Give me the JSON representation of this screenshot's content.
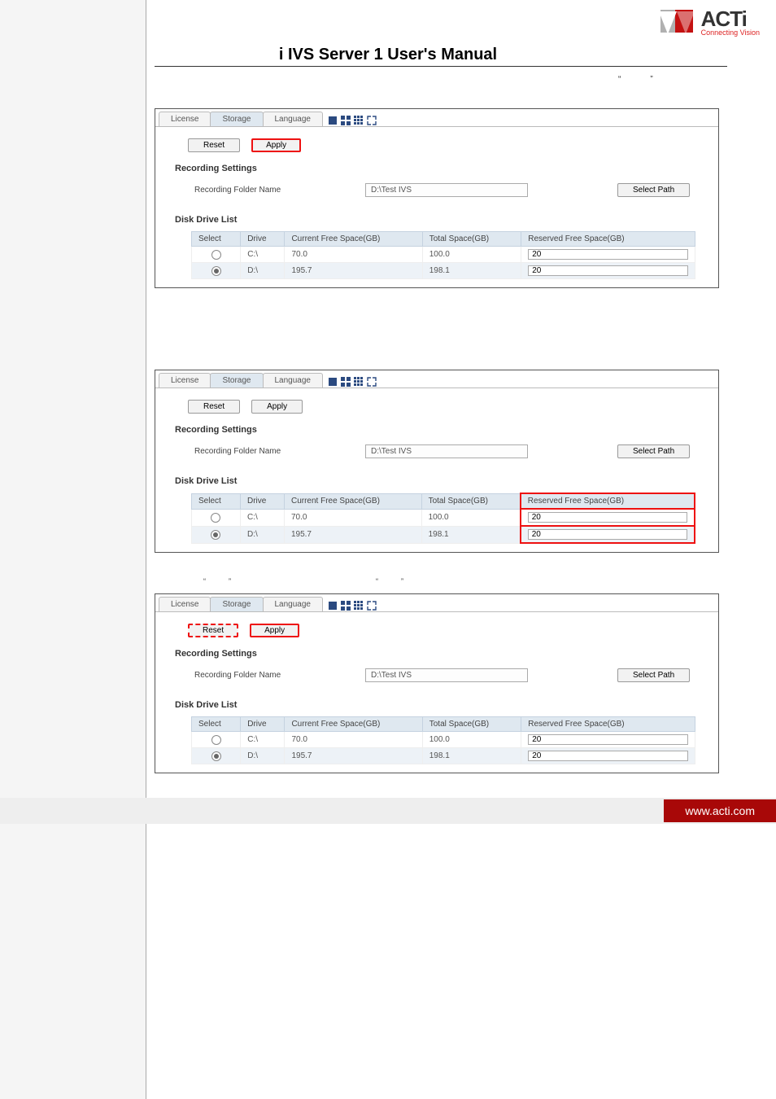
{
  "brand": {
    "name": "ACTi",
    "tagline": "Connecting Vision"
  },
  "page_title": "i IVS Server 1 User's Manual",
  "top_open_quote": "“",
  "top_close_quote": "”",
  "panels": {
    "shared": {
      "tabs": {
        "license": "License",
        "storage": "Storage",
        "language": "Language"
      },
      "buttons": {
        "reset": "Reset",
        "apply": "Apply",
        "select_path": "Select Path"
      },
      "recording_settings_label": "Recording Settings",
      "recording_folder_name_label": "Recording Folder Name",
      "recording_folder_value": "D:\\Test IVS",
      "disk_drive_list_label": "Disk Drive List",
      "columns": {
        "select": "Select",
        "drive": "Drive",
        "current_free": "Current Free Space(GB)",
        "total": "Total Space(GB)",
        "reserved": "Reserved Free Space(GB)"
      },
      "rows": [
        {
          "drive": "C:\\",
          "current_free": "70.0",
          "total": "100.0",
          "reserved": "20",
          "selected": false
        },
        {
          "drive": "D:\\",
          "current_free": "195.7",
          "total": "198.1",
          "reserved": "20",
          "selected": true
        }
      ]
    }
  },
  "mid_quotes": {
    "a_open": "“",
    "a_close": "”",
    "b_open": "“",
    "b_close": "”"
  },
  "footer": {
    "url": "www.acti.com"
  }
}
